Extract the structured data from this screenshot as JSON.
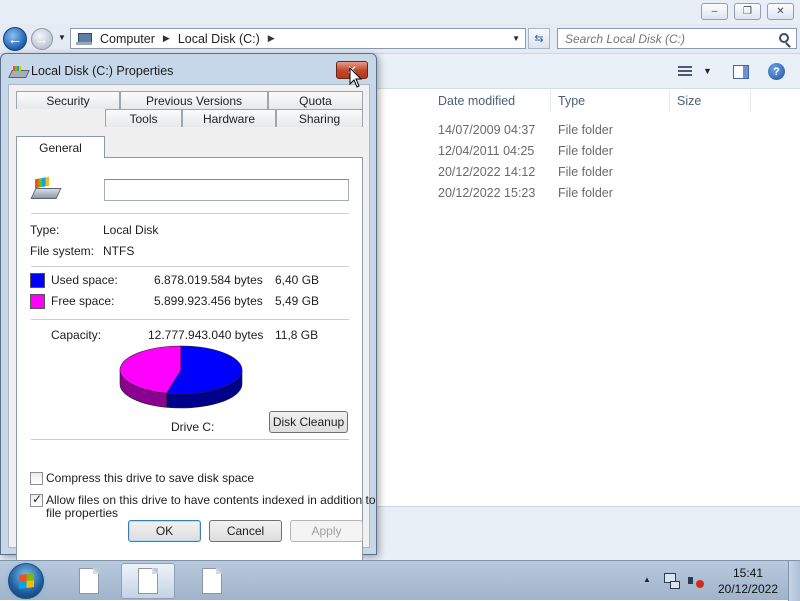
{
  "explorer": {
    "caption": {
      "minimize": "–",
      "maximize": "❐",
      "close": "✕"
    },
    "address": {
      "segments": [
        "Computer",
        "Local Disk (C:)"
      ]
    },
    "search": {
      "placeholder": "Search Local Disk (C:)"
    },
    "columns": [
      "Date modified",
      "Type",
      "Size"
    ],
    "rows": [
      {
        "date": "14/07/2009 04:37",
        "type": "File folder"
      },
      {
        "date": "12/04/2011 04:25",
        "type": "File folder"
      },
      {
        "date": "20/12/2022 14:12",
        "type": "File folder"
      },
      {
        "date": "20/12/2022 15:23",
        "type": "File folder"
      }
    ]
  },
  "dialog": {
    "title": "Local Disk (C:) Properties",
    "close_glyph": "✕",
    "tabs_back": [
      "Security",
      "Previous Versions",
      "Quota"
    ],
    "tabs_front": [
      "General",
      "Tools",
      "Hardware",
      "Sharing"
    ],
    "label_value": "",
    "type_label": "Type:",
    "type_value": "Local Disk",
    "fs_label": "File system:",
    "fs_value": "NTFS",
    "used": {
      "label": "Used space:",
      "bytes": "6.878.019.584 bytes",
      "size": "6,40 GB",
      "color": "#0000ff"
    },
    "free": {
      "label": "Free space:",
      "bytes": "5.899.923.456 bytes",
      "size": "5,49 GB",
      "color": "#ff00ff"
    },
    "capacity": {
      "label": "Capacity:",
      "bytes": "12.777.943.040 bytes",
      "size": "11,8 GB"
    },
    "drive_label": "Drive C:",
    "used_fraction": 0.538,
    "disk_cleanup": "Disk Cleanup",
    "compress": {
      "label": "Compress this drive to save disk space",
      "checked": false
    },
    "index": {
      "line1": "Allow files on this drive to have contents indexed in addition to",
      "line2": "file properties",
      "checked": true
    },
    "buttons": {
      "ok": "OK",
      "cancel": "Cancel",
      "apply": "Apply"
    }
  },
  "taskbar": {
    "clock_time": "15:41",
    "clock_date": "20/12/2022",
    "tray_arrow": "▲"
  }
}
